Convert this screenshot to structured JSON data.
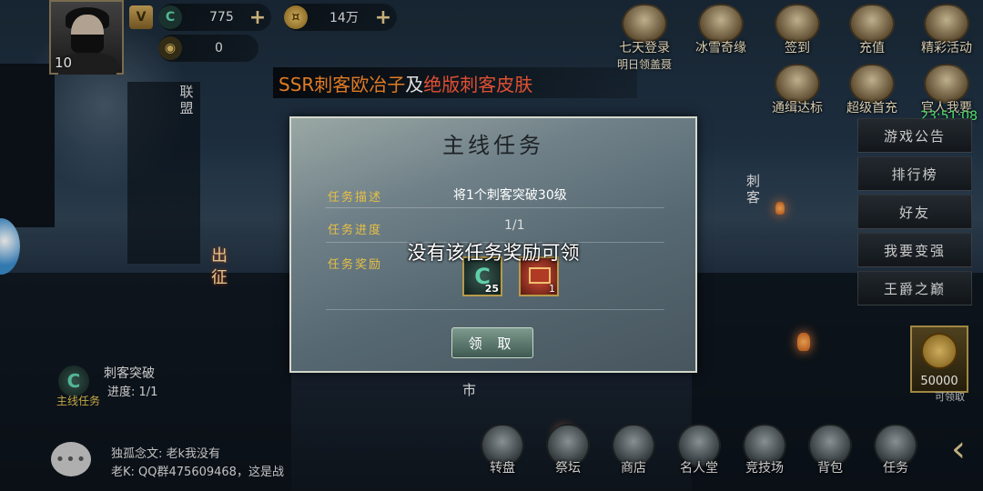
{
  "player": {
    "level": "10",
    "resources": [
      {
        "id": "jade",
        "value": "775"
      },
      {
        "id": "gold",
        "value": "14万"
      },
      {
        "id": "token",
        "value": "0"
      }
    ]
  },
  "banner": {
    "part1": "SSR刺客欧冶子",
    "part2": "及",
    "part3": "绝版刺客皮肤"
  },
  "activities": [
    {
      "label": "七天登录",
      "sub": "明日领盖聂"
    },
    {
      "label": "冰雪奇缘",
      "sub": ""
    },
    {
      "label": "签到",
      "sub": ""
    },
    {
      "label": "充值",
      "sub": ""
    },
    {
      "label": "精彩活动",
      "sub": ""
    },
    {
      "label": "通缉达标",
      "sub": ""
    },
    {
      "label": "超级首充",
      "sub": ""
    },
    {
      "label": "官人我要",
      "sub": ""
    }
  ],
  "clock": "23:51:08",
  "right_menu": [
    "游戏公告",
    "排行榜",
    "好友",
    "我要变强",
    "王爵之巅"
  ],
  "treasure": {
    "value": "50000",
    "sub": "可领取"
  },
  "side_tabs": {
    "alliance": "联盟",
    "expedition": "出征",
    "assassin": "刺客",
    "market": "市"
  },
  "quest_tracker": {
    "title": "刺客突破",
    "progress": "进度: 1/1",
    "label": "主线任务"
  },
  "chat": [
    {
      "text": "独孤念文:  老k我没有"
    },
    {
      "text": "老K:  QQ群475609468，这是战"
    }
  ],
  "bottom_nav": [
    "转盘",
    "祭坛",
    "商店",
    "名人堂",
    "竞技场",
    "背包",
    "任务"
  ],
  "modal": {
    "title": "主线任务",
    "desc_label": "任务描述",
    "desc_value": "将1个刺客突破30级",
    "progress_label": "任务进度",
    "progress_value": "1/1",
    "reward_label": "任务奖励",
    "rewards": [
      {
        "count": "25"
      },
      {
        "count": "1"
      }
    ],
    "claim_label": "领 取"
  },
  "toast": "没有该任务奖励可领",
  "colors": {
    "accent_gold": "#e8c044",
    "clock_green": "#5aff7a",
    "banner_orange": "#ff8c2a",
    "banner_red": "#ff5a3a"
  }
}
